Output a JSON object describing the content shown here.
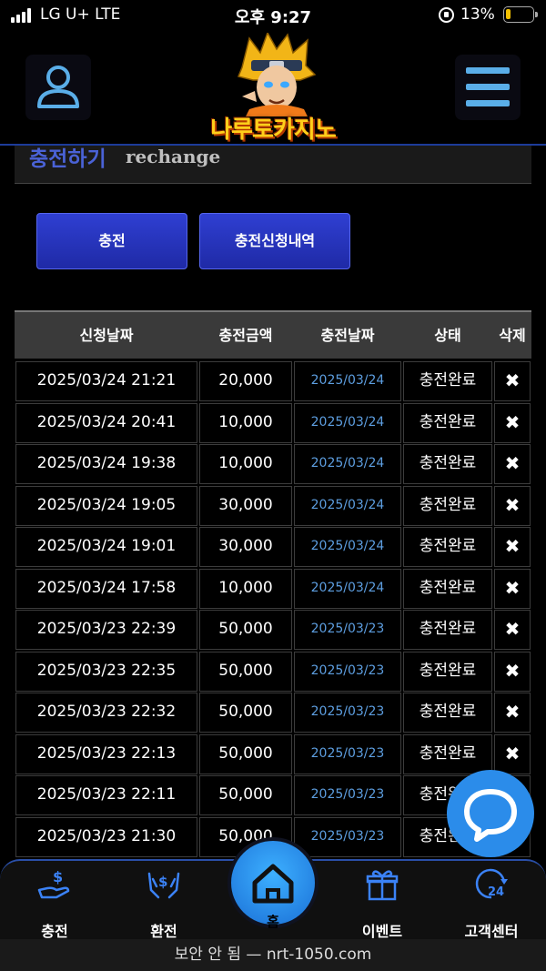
{
  "status_bar": {
    "carrier": "LG U+  LTE",
    "time": "오후 9:27",
    "battery": "13%"
  },
  "header": {
    "logo_text": "나루토카지노",
    "user_icon": "user-icon",
    "menu_icon": "hamburger-menu-icon"
  },
  "title": {
    "korean": "충전하기",
    "english": "rechange"
  },
  "buttons": {
    "charge": "충전",
    "history": "충전신청내역"
  },
  "table": {
    "headers": [
      "신청날짜",
      "충전금액",
      "충전날짜",
      "상태",
      "삭제"
    ],
    "delete_symbol": "✖",
    "rows": [
      {
        "requested": "2025/03/24 21:21",
        "amount": "20,000",
        "date": "2025/03/24",
        "status": "충전완료"
      },
      {
        "requested": "2025/03/24 20:41",
        "amount": "10,000",
        "date": "2025/03/24",
        "status": "충전완료"
      },
      {
        "requested": "2025/03/24 19:38",
        "amount": "10,000",
        "date": "2025/03/24",
        "status": "충전완료"
      },
      {
        "requested": "2025/03/24 19:05",
        "amount": "30,000",
        "date": "2025/03/24",
        "status": "충전완료"
      },
      {
        "requested": "2025/03/24 19:01",
        "amount": "30,000",
        "date": "2025/03/24",
        "status": "충전완료"
      },
      {
        "requested": "2025/03/24 17:58",
        "amount": "10,000",
        "date": "2025/03/24",
        "status": "충전완료"
      },
      {
        "requested": "2025/03/23 22:39",
        "amount": "50,000",
        "date": "2025/03/23",
        "status": "충전완료"
      },
      {
        "requested": "2025/03/23 22:35",
        "amount": "50,000",
        "date": "2025/03/23",
        "status": "충전완료"
      },
      {
        "requested": "2025/03/23 22:32",
        "amount": "50,000",
        "date": "2025/03/23",
        "status": "충전완료"
      },
      {
        "requested": "2025/03/23 22:13",
        "amount": "50,000",
        "date": "2025/03/23",
        "status": "충전완료"
      },
      {
        "requested": "2025/03/23 22:11",
        "amount": "50,000",
        "date": "2025/03/23",
        "status": "충전완료"
      },
      {
        "requested": "2025/03/23 21:30",
        "amount": "50,000",
        "date": "2025/03/23",
        "status": "충전완료"
      }
    ]
  },
  "chat_icon": "chat-bubble-icon",
  "bottom_nav": {
    "charge": "충전",
    "exchange": "환전",
    "home": "홈",
    "event": "이벤트",
    "support": "고객센터"
  },
  "url_bar": "보안 안 됨 — nrt-1050.com",
  "colors": {
    "accent_blue": "#2f3fd2",
    "date_blue": "#5d9ee0",
    "icon_blue": "#5aaee8"
  }
}
